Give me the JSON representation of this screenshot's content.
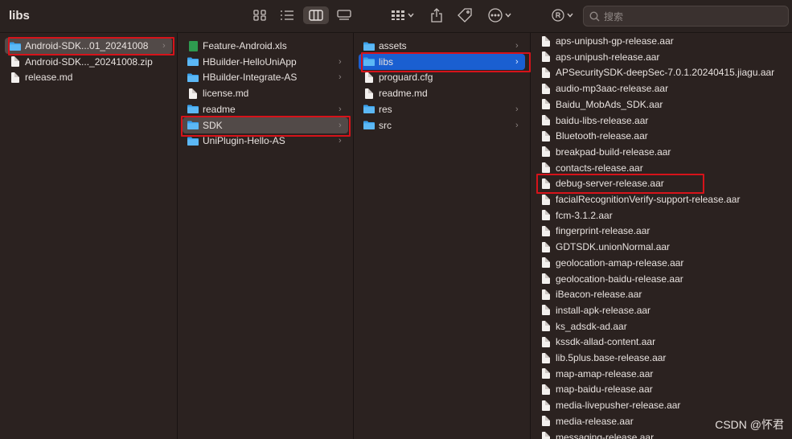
{
  "window": {
    "title": "libs"
  },
  "toolbar": {
    "search_placeholder": "搜索",
    "buttons": [
      "icon-view",
      "list-view",
      "column-view",
      "gallery-view",
      "group",
      "share",
      "tag",
      "more",
      "profile"
    ]
  },
  "columns": [
    {
      "items": [
        {
          "label": "Android-SDK...01_20241008",
          "type": "folder",
          "selected": true,
          "arrow": true
        },
        {
          "label": "Android-SDK..._20241008.zip",
          "type": "file"
        },
        {
          "label": "release.md",
          "type": "file"
        }
      ]
    },
    {
      "items": [
        {
          "label": "Feature-Android.xls",
          "type": "xls"
        },
        {
          "label": "HBuilder-HelloUniApp",
          "type": "folder",
          "arrow": true
        },
        {
          "label": "HBuilder-Integrate-AS",
          "type": "folder",
          "arrow": true
        },
        {
          "label": "license.md",
          "type": "file"
        },
        {
          "label": "readme",
          "type": "folder",
          "arrow": true
        },
        {
          "label": "SDK",
          "type": "folder",
          "selected": true,
          "arrow": true
        },
        {
          "label": "UniPlugin-Hello-AS",
          "type": "folder",
          "arrow": true
        }
      ]
    },
    {
      "items": [
        {
          "label": "assets",
          "type": "folder",
          "arrow": true
        },
        {
          "label": "libs",
          "type": "folder",
          "selected": true,
          "arrow": true
        },
        {
          "label": "proguard.cfg",
          "type": "file"
        },
        {
          "label": "readme.md",
          "type": "file"
        },
        {
          "label": "res",
          "type": "folder",
          "arrow": true
        },
        {
          "label": "src",
          "type": "folder",
          "arrow": true
        }
      ]
    },
    {
      "items": [
        {
          "label": "aps-unipush-gp-release.aar",
          "type": "file"
        },
        {
          "label": "aps-unipush-release.aar",
          "type": "file"
        },
        {
          "label": "APSecuritySDK-deepSec-7.0.1.20240415.jiagu.aar",
          "type": "file"
        },
        {
          "label": "audio-mp3aac-release.aar",
          "type": "file"
        },
        {
          "label": "Baidu_MobAds_SDK.aar",
          "type": "file"
        },
        {
          "label": "baidu-libs-release.aar",
          "type": "file"
        },
        {
          "label": "Bluetooth-release.aar",
          "type": "file"
        },
        {
          "label": "breakpad-build-release.aar",
          "type": "file"
        },
        {
          "label": "contacts-release.aar",
          "type": "file"
        },
        {
          "label": "debug-server-release.aar",
          "type": "file"
        },
        {
          "label": "facialRecognitionVerify-support-release.aar",
          "type": "file"
        },
        {
          "label": "fcm-3.1.2.aar",
          "type": "file"
        },
        {
          "label": "fingerprint-release.aar",
          "type": "file"
        },
        {
          "label": "GDTSDK.unionNormal.aar",
          "type": "file"
        },
        {
          "label": "geolocation-amap-release.aar",
          "type": "file"
        },
        {
          "label": "geolocation-baidu-release.aar",
          "type": "file"
        },
        {
          "label": "iBeacon-release.aar",
          "type": "file"
        },
        {
          "label": "install-apk-release.aar",
          "type": "file"
        },
        {
          "label": "ks_adsdk-ad.aar",
          "type": "file"
        },
        {
          "label": "kssdk-allad-content.aar",
          "type": "file"
        },
        {
          "label": "lib.5plus.base-release.aar",
          "type": "file"
        },
        {
          "label": "map-amap-release.aar",
          "type": "file"
        },
        {
          "label": "map-baidu-release.aar",
          "type": "file"
        },
        {
          "label": "media-livepusher-release.aar",
          "type": "file"
        },
        {
          "label": "media-release.aar",
          "type": "file"
        },
        {
          "label": "messaging-release.aar",
          "type": "file"
        }
      ]
    }
  ],
  "watermark": "CSDN @怀君"
}
